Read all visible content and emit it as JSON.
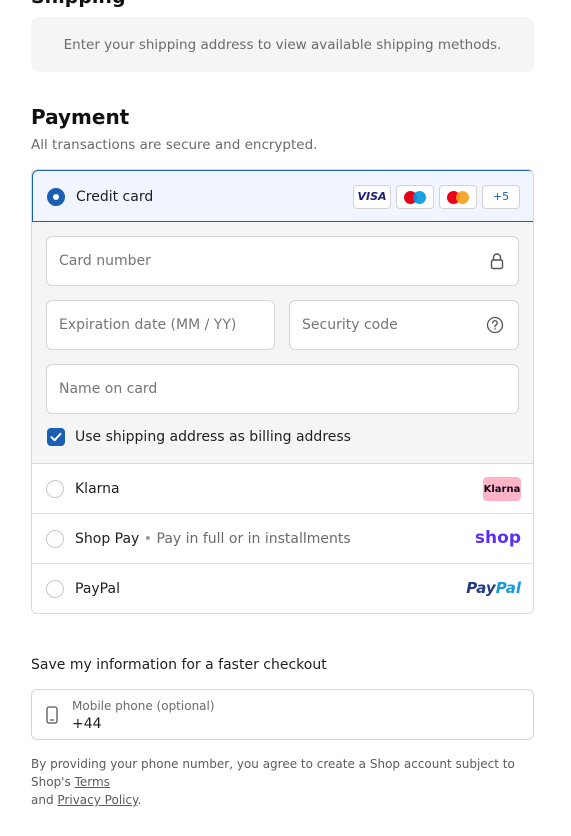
{
  "shipping": {
    "heading_partial": "Shipping",
    "notice": "Enter your shipping address to view available shipping methods."
  },
  "payment": {
    "title": "Payment",
    "subtitle": "All transactions are secure and encrypted.",
    "credit_card": {
      "label": "Credit card",
      "selected": true,
      "brands": [
        {
          "name": "visa",
          "text": "VISA",
          "color": "#1a1f71"
        },
        {
          "name": "maestro",
          "colors": [
            "#eb001b",
            "#0099df"
          ]
        },
        {
          "name": "mastercard",
          "colors": [
            "#eb001b",
            "#f79e1b"
          ]
        },
        {
          "name": "more",
          "text": "+5"
        }
      ],
      "fields": {
        "card_number": {
          "placeholder": "Card number",
          "icon": "lock-icon"
        },
        "expiration": {
          "placeholder": "Expiration date (MM / YY)"
        },
        "security_code": {
          "placeholder": "Security code",
          "icon": "help-circle-icon"
        },
        "name_on_card": {
          "placeholder": "Name on card"
        }
      },
      "billing_checkbox": {
        "label": "Use shipping address as billing address",
        "checked": true
      }
    },
    "options": [
      {
        "label": "Klarna",
        "logo_text": "Klarna",
        "selected": false
      },
      {
        "label": "Shop Pay",
        "separator": "•",
        "sublabel": "Pay in full or in installments",
        "logo_text": "shop",
        "selected": false
      },
      {
        "label": "PayPal",
        "logo_text_a": "Pay",
        "logo_text_b": "Pal",
        "selected": false
      }
    ]
  },
  "save_info": {
    "title": "Save my information for a faster checkout",
    "phone": {
      "label": "Mobile phone (optional)",
      "value": "+44",
      "icon": "phone-icon"
    }
  },
  "disclaimer": {
    "text": "By providing your phone number, you agree to create a Shop account subject to Shop's",
    "terms_link": "Terms",
    "and": "and",
    "privacy_link": "Privacy Policy",
    "end": "."
  },
  "colors": {
    "accent": "#1a5fb4",
    "selected_bg": "#f0f5ff",
    "notice_bg": "#f5f5f5",
    "klarna_pink": "#ffb3c7",
    "shop_purple": "#5a31f4"
  }
}
